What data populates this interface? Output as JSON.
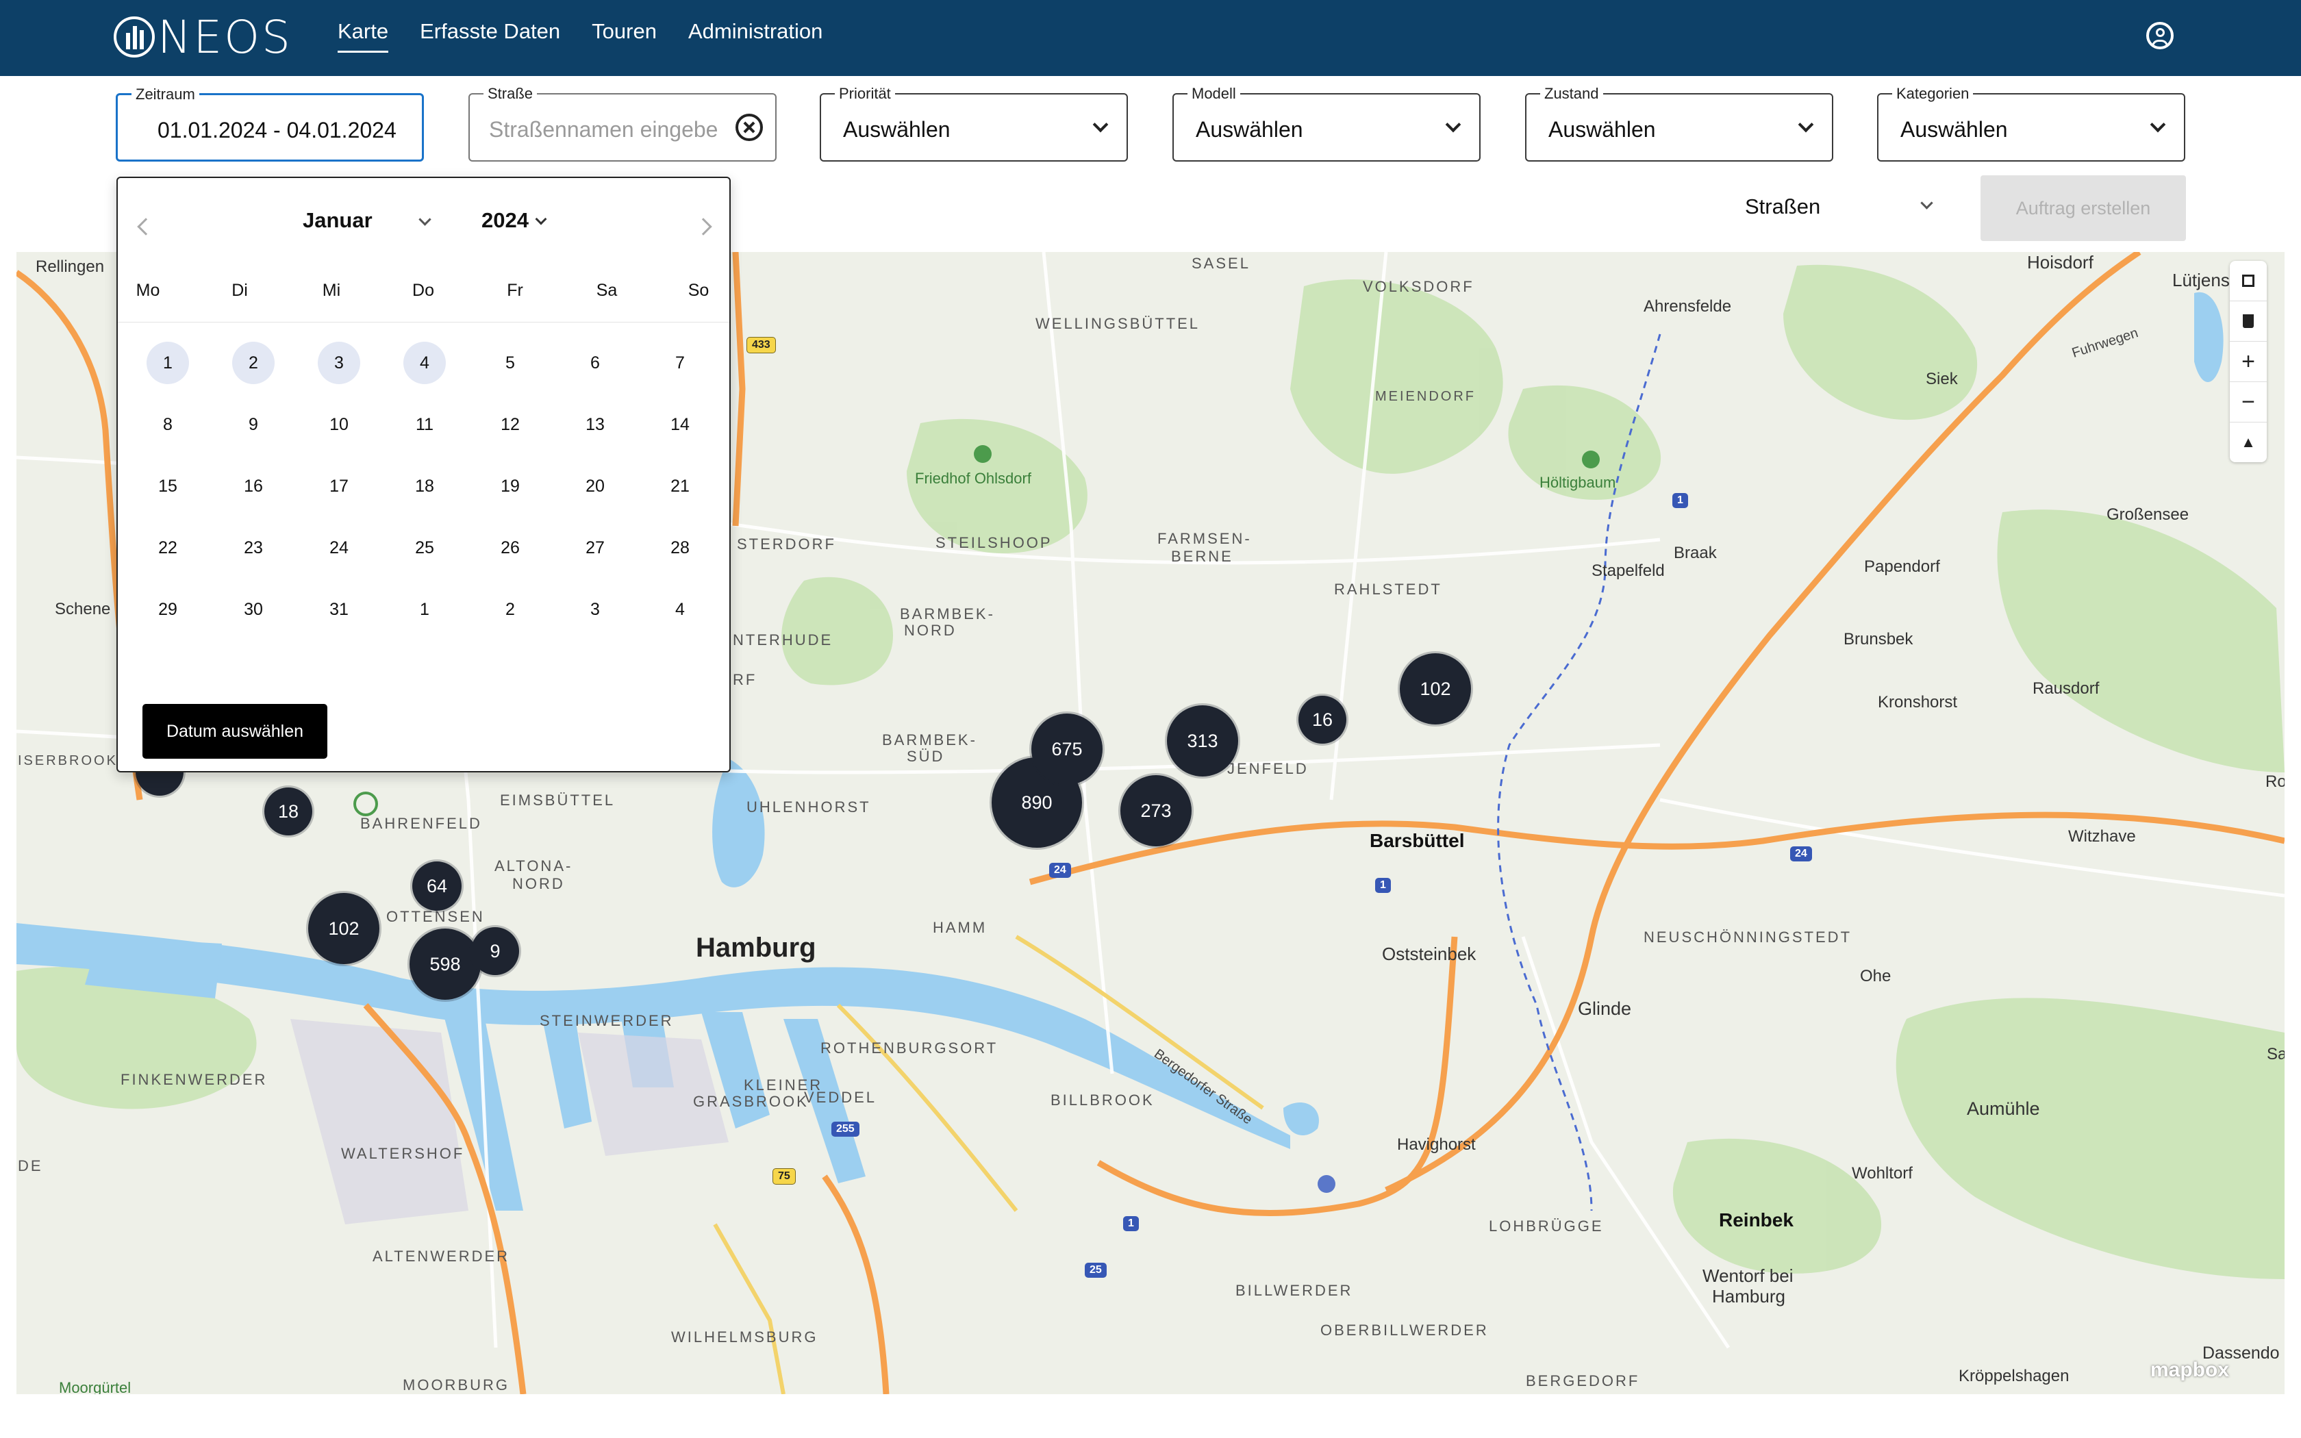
{
  "app": {
    "logo_text": "NEOS"
  },
  "nav": [
    {
      "label": "Karte",
      "active": true
    },
    {
      "label": "Erfasste Daten",
      "active": false
    },
    {
      "label": "Touren",
      "active": false
    },
    {
      "label": "Administration",
      "active": false
    }
  ],
  "filters": {
    "zeitraum": {
      "label": "Zeitraum",
      "value": "01.01.2024 - 04.01.2024"
    },
    "strasse": {
      "label": "Straße",
      "placeholder": "Straßennamen eingebe"
    },
    "prioritaet": {
      "label": "Priorität",
      "value": "Auswählen"
    },
    "modell": {
      "label": "Modell",
      "value": "Auswählen"
    },
    "zustand": {
      "label": "Zustand",
      "value": "Auswählen"
    },
    "kategorien": {
      "label": "Kategorien",
      "value": "Auswählen"
    }
  },
  "layer_select": {
    "value": "Straßen"
  },
  "order_button": {
    "label": "Auftrag erstellen",
    "disabled": true
  },
  "datepicker": {
    "month": "Januar",
    "year": "2024",
    "weekdays": [
      "Mo",
      "Di",
      "Mi",
      "Do",
      "Fr",
      "Sa",
      "So"
    ],
    "weeks": [
      [
        "1",
        "2",
        "3",
        "4",
        "5",
        "6",
        "7"
      ],
      [
        "8",
        "9",
        "10",
        "11",
        "12",
        "13",
        "14"
      ],
      [
        "15",
        "16",
        "17",
        "18",
        "19",
        "20",
        "21"
      ],
      [
        "22",
        "23",
        "24",
        "25",
        "26",
        "27",
        "28"
      ],
      [
        "29",
        "30",
        "31",
        "1",
        "2",
        "3",
        "4"
      ]
    ],
    "selected": [
      "1",
      "2",
      "3",
      "4"
    ],
    "confirm_label": "Datum auswählen"
  },
  "map": {
    "clusters": [
      "890",
      "675",
      "313",
      "273",
      "16",
      "102",
      "18",
      "64",
      "102",
      "598",
      "9",
      "64"
    ],
    "labels": {
      "rellingen": "Rellingen",
      "schene": "Schene",
      "iserbrook": "ISERBROOK",
      "sasel": "SASEL",
      "volksdorf": "VOLKSDORF",
      "wellingsbuettel": "WELLINGSBÜTTEL",
      "meiendorf": "MEIENDORF",
      "friedhof": "Friedhof Ohlsdorf",
      "hoeltigbaum": "Höltigbaum",
      "steilshoop": "STEILSHOOP",
      "farmsen": "FARMSEN-",
      "farmsen2": "BERNE",
      "sterdorf": "STERDORF",
      "rahlstedt": "RAHLSTEDT",
      "barmbek_nord": "BARMBEK-",
      "barmbek_nord2": "NORD",
      "barmbek_sued": "BARMBEK-",
      "barmbek_sued2": "SÜD",
      "interhude": "NTERHUDE",
      "rf": "RF",
      "uhlenhorst": "UHLENHORST",
      "jenfeld": "JENFELD",
      "eimsbuettel": "EIMSBÜTTEL",
      "bahrenfeld": "BAHRENFELD",
      "altona": "ALTONA-",
      "altona2": "NORD",
      "ottensen": "OTTENSEN",
      "hamburg": "Hamburg",
      "hamm": "HAMM",
      "steinwerder": "STEINWERDER",
      "rothenburgsort": "ROTHENBURGSORT",
      "kleiner": "KLEINER",
      "grasbrook": "GRASBROOK",
      "veddel": "VEDDEL",
      "billbrook": "BILLBROOK",
      "finkenwerder": "FINKENWERDER",
      "waltershof": "WALTERSHOF",
      "de": "DE",
      "altenwerder": "ALTENWERDER",
      "wilhelmsburg": "WILHELMSBURG",
      "moorburg": "MOORBURG",
      "moorguertel": "Moorgürtel",
      "ahrensfelde": "Ahrensfelde",
      "hoisdorf": "Hoisdorf",
      "luetjens": "Lütjens",
      "fuhrwegen": "Fuhrwegen",
      "siek": "Siek",
      "grossensee": "Großensee",
      "braak": "Braak",
      "stapelfeld": "Stapelfeld",
      "papendorf": "Papendorf",
      "brunsbek": "Brunsbek",
      "rausdorf": "Rausdorf",
      "kronshorst": "Kronshorst",
      "ro": "Ro",
      "barsbuettel": "Barsbüttel",
      "witzhave": "Witzhave",
      "oststeinbek": "Oststeinbek",
      "neuschoenningstedt": "NEUSCHÖNNINGSTEDT",
      "ohe": "Ohe",
      "glinde": "Glinde",
      "sa": "Sa",
      "aumuehle": "Aumühle",
      "havighorst": "Havighorst",
      "wohltorf": "Wohltorf",
      "lohbruegge": "LOHBRÜGGE",
      "reinbek": "Reinbek",
      "wentorf": "Wentorf bei",
      "wentorf2": "Hamburg",
      "billwerder": "BILLWERDER",
      "oberbillwerder": "OBERBILLWERDER",
      "bergedorf": "BERGEDORF",
      "dassendorf": "Dassendo",
      "kroeppelshagen": "Kröppelshagen",
      "bergedorfer": "Bergedorfer Straße"
    },
    "shields": [
      "433",
      "1",
      "24",
      "1",
      "24",
      "255",
      "75",
      "1",
      "25"
    ],
    "attribution": "mapbox"
  },
  "colors": {
    "header_bg": "#0d4067",
    "focus_border": "#1a73c9",
    "cluster": "#1e2430",
    "motorway": "#f6a04d",
    "water": "#9ccff0"
  }
}
